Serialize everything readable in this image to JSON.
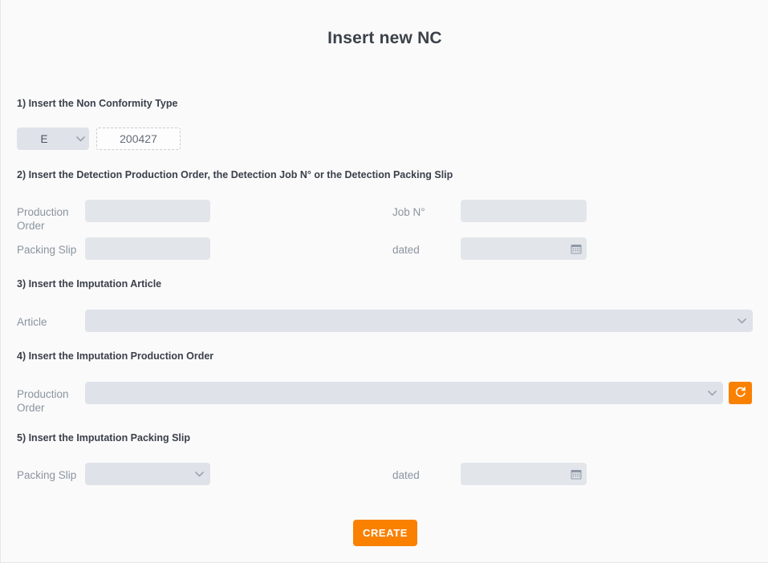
{
  "page": {
    "title": "Insert new NC",
    "accent_color": "#fa8000",
    "background_color": "#fafafa",
    "field_color": "#e2e6ea",
    "label_color": "#8a94a0"
  },
  "sections": [
    {
      "heading": "1) Insert the Non Conformity Type",
      "type_select": {
        "value": "E",
        "icon": "chevron-down-icon"
      },
      "number_field": {
        "value": "200427"
      }
    },
    {
      "heading": "2) Insert the Detection Production Order, the Detection Job N° or the Detection Packing Slip",
      "fields": [
        {
          "label": "Production Order",
          "value": ""
        },
        {
          "label": "Job N°",
          "value": ""
        },
        {
          "label": "Packing Slip",
          "value": ""
        },
        {
          "label": "dated",
          "value": "",
          "icon": "calendar-icon"
        }
      ]
    },
    {
      "heading": "3) Insert the Imputation Article",
      "fields": [
        {
          "label": "Article",
          "value": "",
          "icon": "chevron-down-icon"
        }
      ]
    },
    {
      "heading": "4) Insert the Imputation Production Order",
      "fields": [
        {
          "label": "Production Order",
          "value": "",
          "icon": "chevron-down-icon"
        }
      ],
      "refresh_button": {
        "icon": "refresh-icon"
      }
    },
    {
      "heading": "5) Insert the Imputation Packing Slip",
      "fields": [
        {
          "label": "Packing Slip",
          "value": "",
          "icon": "chevron-down-icon"
        },
        {
          "label": "dated",
          "value": "",
          "icon": "calendar-icon"
        }
      ]
    }
  ],
  "actions": {
    "create_label": "CREATE"
  }
}
